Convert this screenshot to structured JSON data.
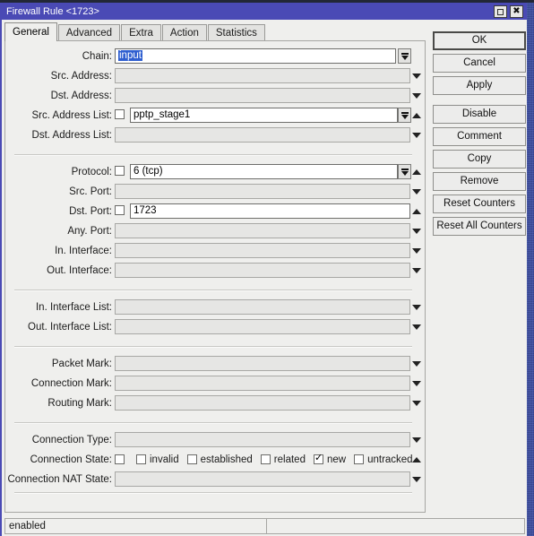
{
  "window": {
    "title": "Firewall Rule <1723>",
    "maximize_icon": "maximize-icon",
    "close_icon": "close-icon",
    "close_glyph": "✖"
  },
  "tabs": [
    {
      "label": "General",
      "active": true
    },
    {
      "label": "Advanced",
      "active": false
    },
    {
      "label": "Extra",
      "active": false
    },
    {
      "label": "Action",
      "active": false
    },
    {
      "label": "Statistics",
      "active": false
    }
  ],
  "fields": {
    "chain": {
      "label": "Chain:",
      "value": "input",
      "selected": true,
      "enabled": true
    },
    "src_address": {
      "label": "Src. Address:",
      "value": "",
      "enabled": false
    },
    "dst_address": {
      "label": "Dst. Address:",
      "value": "",
      "enabled": false
    },
    "src_address_list": {
      "label": "Src. Address List:",
      "value": "pptp_stage1",
      "checkbox": false,
      "enabled": true
    },
    "dst_address_list": {
      "label": "Dst. Address List:",
      "value": "",
      "enabled": false
    },
    "protocol": {
      "label": "Protocol:",
      "value": "6 (tcp)",
      "checkbox": false,
      "enabled": true
    },
    "src_port": {
      "label": "Src. Port:",
      "value": "",
      "enabled": false
    },
    "dst_port": {
      "label": "Dst. Port:",
      "value": "1723",
      "checkbox": false,
      "enabled": true
    },
    "any_port": {
      "label": "Any. Port:",
      "value": "",
      "enabled": false
    },
    "in_interface": {
      "label": "In. Interface:",
      "value": "",
      "enabled": false
    },
    "out_interface": {
      "label": "Out. Interface:",
      "value": "",
      "enabled": false
    },
    "in_interface_list": {
      "label": "In. Interface List:",
      "value": "",
      "enabled": false
    },
    "out_interface_list": {
      "label": "Out. Interface List:",
      "value": "",
      "enabled": false
    },
    "packet_mark": {
      "label": "Packet Mark:",
      "value": "",
      "enabled": false
    },
    "connection_mark": {
      "label": "Connection Mark:",
      "value": "",
      "enabled": false
    },
    "routing_mark": {
      "label": "Routing Mark:",
      "value": "",
      "enabled": false
    },
    "connection_type": {
      "label": "Connection Type:",
      "value": "",
      "enabled": false
    },
    "connection_state": {
      "label": "Connection State:",
      "options": [
        {
          "label": "",
          "checked": false
        },
        {
          "label": "invalid",
          "checked": false
        },
        {
          "label": "established",
          "checked": false
        },
        {
          "label": "related",
          "checked": false
        },
        {
          "label": "new",
          "checked": true
        },
        {
          "label": "untracked",
          "checked": false
        }
      ]
    },
    "connection_nat_state": {
      "label": "Connection NAT State:",
      "value": "",
      "enabled": false
    }
  },
  "buttons": [
    {
      "label": "OK",
      "primary": true
    },
    {
      "label": "Cancel",
      "primary": false
    },
    {
      "label": "Apply",
      "primary": false
    },
    {
      "label": "Disable",
      "primary": false
    },
    {
      "label": "Comment",
      "primary": false
    },
    {
      "label": "Copy",
      "primary": false
    },
    {
      "label": "Remove",
      "primary": false
    },
    {
      "label": "Reset Counters",
      "primary": false
    },
    {
      "label": "Reset All Counters",
      "primary": false
    }
  ],
  "statusbar": {
    "left": "enabled",
    "right": ""
  },
  "colors": {
    "titlebar": "#4a4ab5",
    "selection": "#2f5fd0",
    "face": "#efefed"
  }
}
